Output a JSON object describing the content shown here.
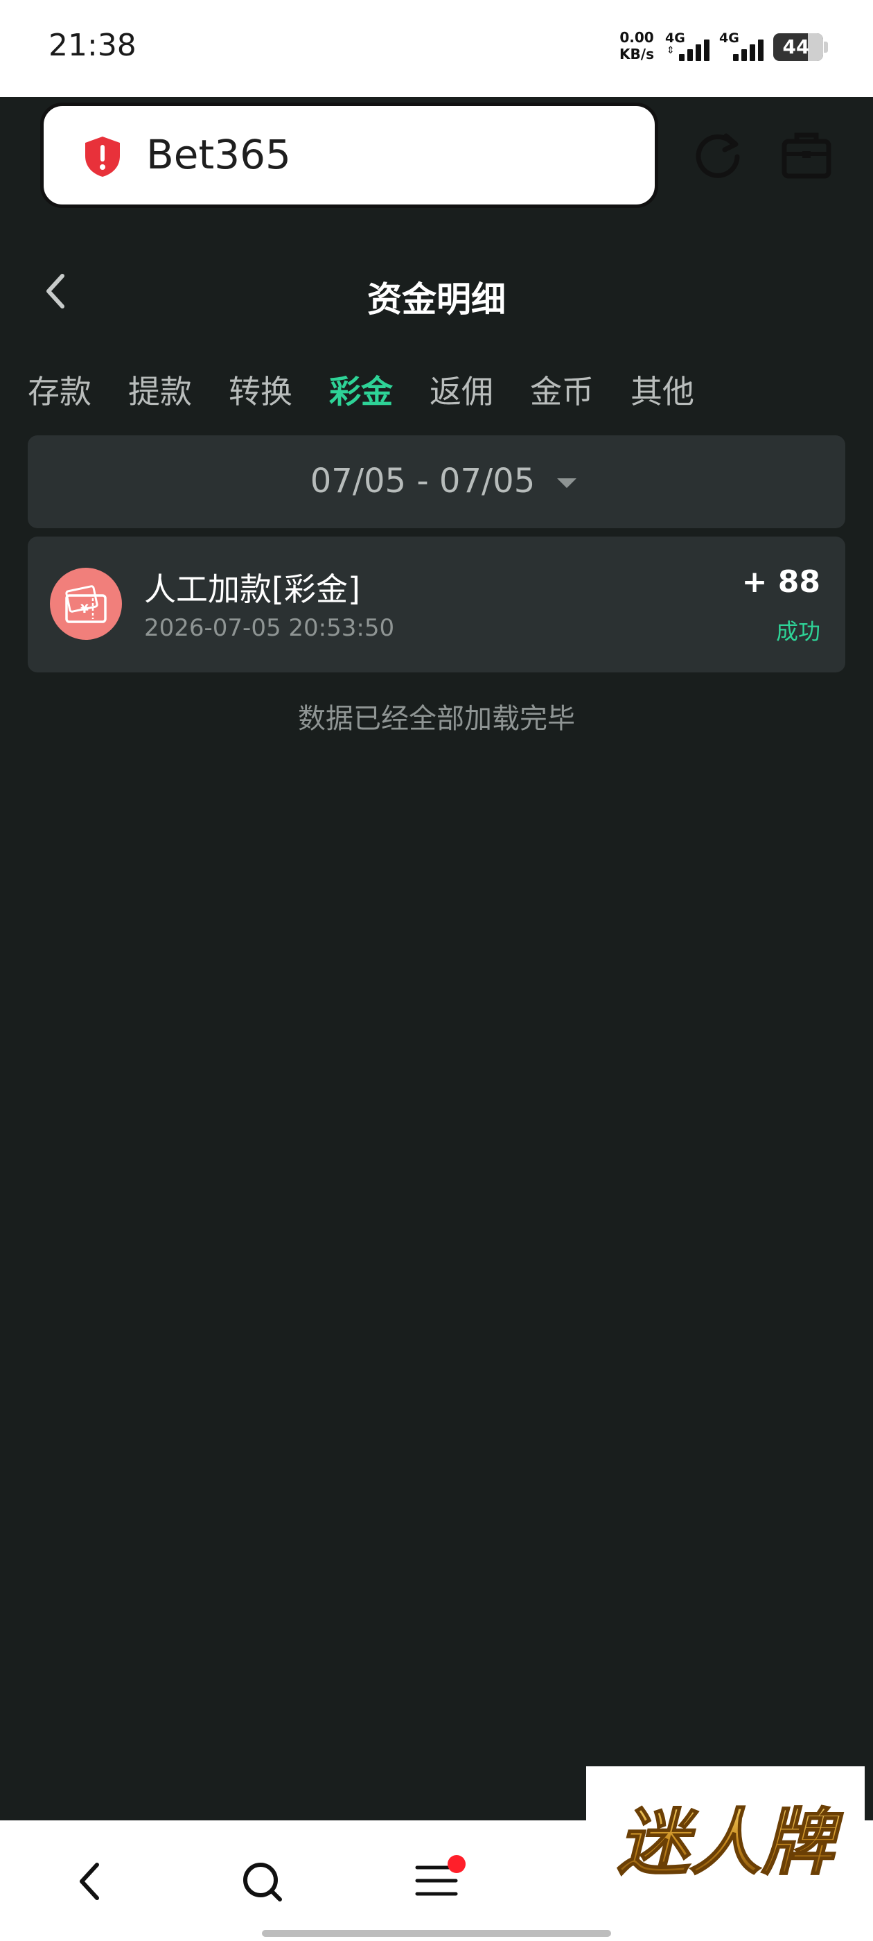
{
  "status_bar": {
    "time": "21:38",
    "net_speed_value": "0.00",
    "net_speed_unit": "KB/s",
    "signal_1_label": "4G",
    "signal_2_label": "4G",
    "battery": "44"
  },
  "browser": {
    "url": "Bet365",
    "security_icon": "shield-alert-icon",
    "accent": "#e8313a"
  },
  "header": {
    "title": "资金明细"
  },
  "tabs": [
    {
      "label": "存款",
      "active": false
    },
    {
      "label": "提款",
      "active": false
    },
    {
      "label": "转换",
      "active": false
    },
    {
      "label": "彩金",
      "active": true
    },
    {
      "label": "返佣",
      "active": false
    },
    {
      "label": "金币",
      "active": false
    },
    {
      "label": "其他",
      "active": false
    }
  ],
  "filter": {
    "date_range": "07/05 - 07/05"
  },
  "records": [
    {
      "title": "人工加款[彩金]",
      "time": "2026-07-05 20:53:50",
      "amount": "+ 88",
      "status": "成功",
      "icon": "bonus-ticket-icon"
    }
  ],
  "list_end_text": "数据已经全部加载完毕",
  "watermark": {
    "text": "迷人牌"
  },
  "colors": {
    "active_tab": "#2ed397",
    "success": "#2ed397",
    "background": "#191e1d",
    "card": "#2b3132",
    "notification_dot": "#ff1f2a"
  }
}
